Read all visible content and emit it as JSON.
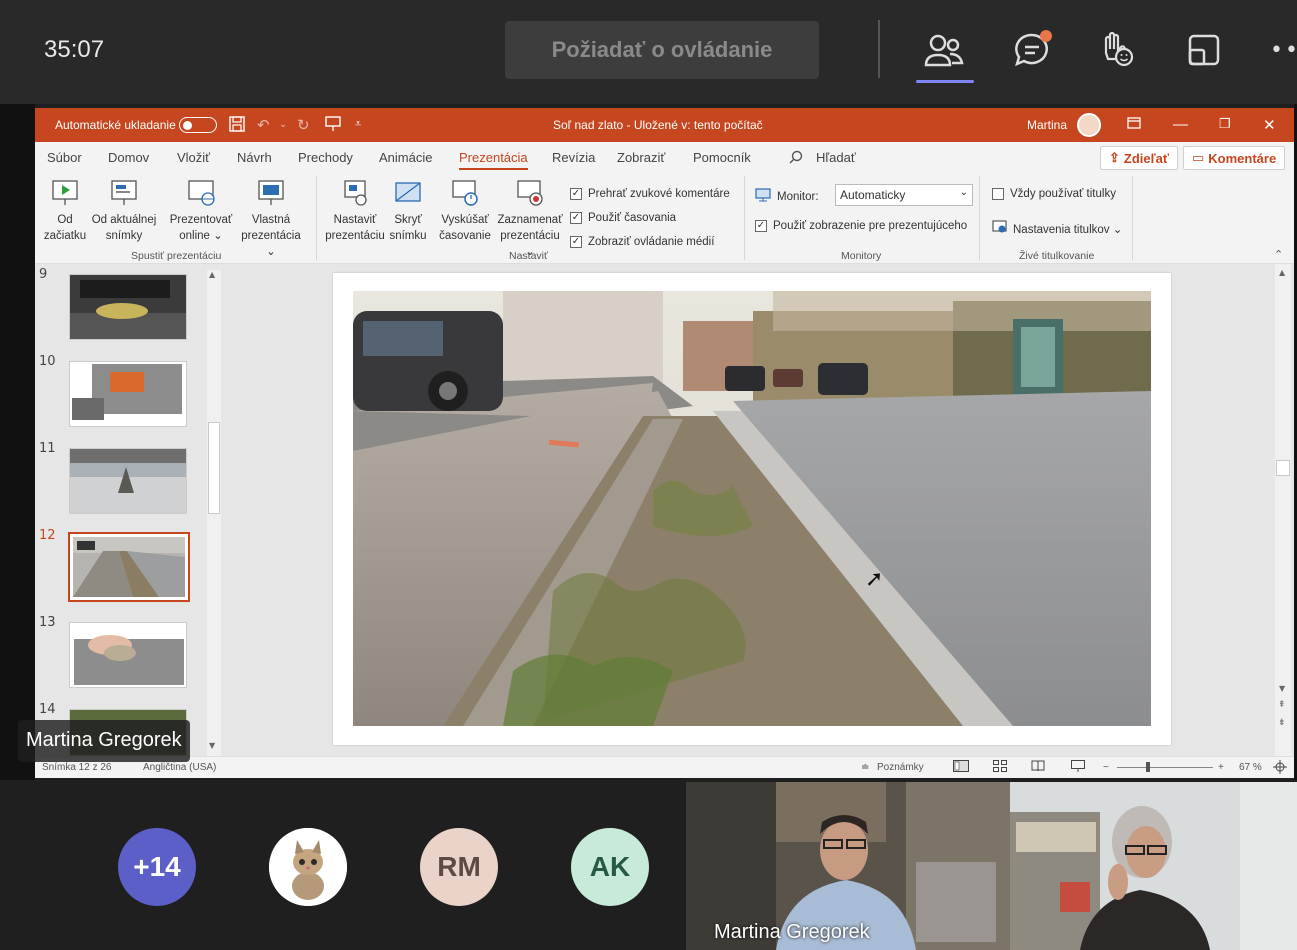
{
  "meeting": {
    "timer": "35:07",
    "request_control_label": "Požiadať o ovládanie",
    "more_label": "••",
    "colors": {
      "bar": "#292929",
      "accent": "#7f85f5",
      "notification": "#e97548"
    }
  },
  "ppt": {
    "autosave_label": "Automatické ukladanie",
    "doc_title": "Soľ nad zlato  -  Uložené v: tento počítač",
    "user_name": "Martina",
    "colors": {
      "brand": "#c5461f"
    },
    "menu": [
      "Súbor",
      "Domov",
      "Vložiť",
      "Návrh",
      "Prechody",
      "Animácie",
      "Prezentácia",
      "Revízia",
      "Zobraziť",
      "Pomocník"
    ],
    "search_label": "Hľadať",
    "share_label": "Zdieľať",
    "comments_label": "Komentáre",
    "ribbon": {
      "from_start": [
        "Od",
        "začiatku"
      ],
      "from_current": [
        "Od aktuálnej",
        "snímky"
      ],
      "present_online": [
        "Prezentovať",
        "online ⌄"
      ],
      "custom_show": [
        "Vlastná",
        "prezentácia ⌄"
      ],
      "group_start": "Spustiť prezentáciu",
      "setup_show": [
        "Nastaviť",
        "prezentáciu"
      ],
      "hide_slide": [
        "Skryť",
        "snímku"
      ],
      "rehearse": [
        "Vyskúšať",
        "časovanie"
      ],
      "record": [
        "Zaznamenať",
        "prezentáciu ⌄"
      ],
      "play_narrations": "Prehrať zvukové komentáre",
      "use_timings": "Použiť časovania",
      "show_media_controls": "Zobraziť ovládanie médií",
      "group_setup": "Nastaviť",
      "monitor_label": "Monitor:",
      "monitor_value": "Automaticky",
      "presenter_view": "Použiť zobrazenie pre prezentujúceho",
      "group_monitors": "Monitory",
      "always_subtitles": "Vždy používať titulky",
      "subtitle_settings": "Nastavenia titulkov ⌄",
      "group_captions": "Živé titulkovanie"
    },
    "slides": [
      {
        "num": "9",
        "selected": false
      },
      {
        "num": "10",
        "selected": false
      },
      {
        "num": "11",
        "selected": false
      },
      {
        "num": "12",
        "selected": true
      },
      {
        "num": "13",
        "selected": false
      },
      {
        "num": "14",
        "selected": false
      }
    ],
    "status": {
      "slide_info": "Snímka 12 z 26",
      "language": "Angličtina (USA)",
      "notes_label": "Poznámky",
      "zoom": "67 %"
    }
  },
  "presenter_tag": "Martina Gregorek",
  "participants": {
    "overflow": "+14",
    "initials": [
      "RM",
      "AK"
    ],
    "video_name": "Martina Gregorek"
  }
}
